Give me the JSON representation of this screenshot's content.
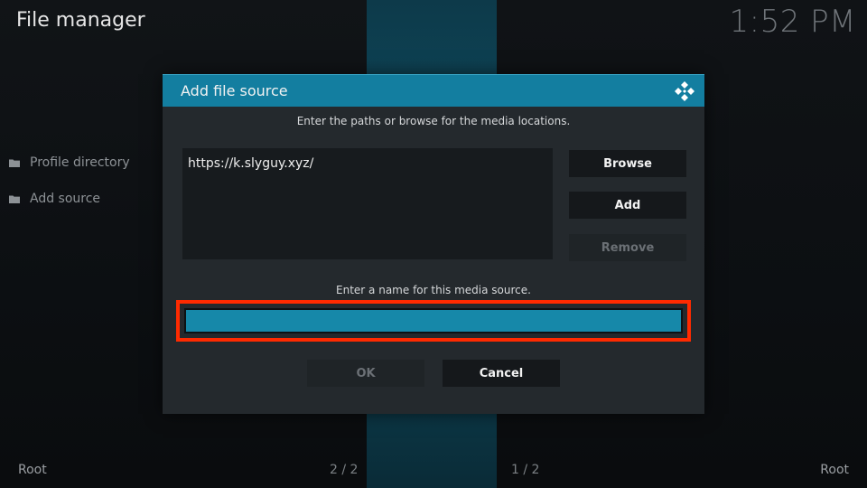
{
  "header": {
    "title": "File manager",
    "clock": "1:52 PM"
  },
  "sidebar": {
    "items": [
      {
        "label": "Profile directory",
        "icon": "folder-icon"
      },
      {
        "label": "Add source",
        "icon": "folder-icon"
      }
    ]
  },
  "footer": {
    "left": "Root",
    "mid_left": "2 / 2",
    "mid_right": "1 / 2",
    "right": "Root"
  },
  "dialog": {
    "title": "Add file source",
    "logo_icon": "kodi-logo-icon",
    "instructions": "Enter the paths or browse for the media locations.",
    "paths": [
      "https://k.slyguy.xyz/"
    ],
    "buttons": {
      "browse": "Browse",
      "add": "Add",
      "remove": "Remove",
      "ok": "OK",
      "cancel": "Cancel"
    },
    "name_prompt": "Enter a name for this media source.",
    "name_value": "",
    "colors": {
      "header": "#137ea0",
      "input": "#1688a9",
      "highlight": "#ff2a00"
    }
  }
}
